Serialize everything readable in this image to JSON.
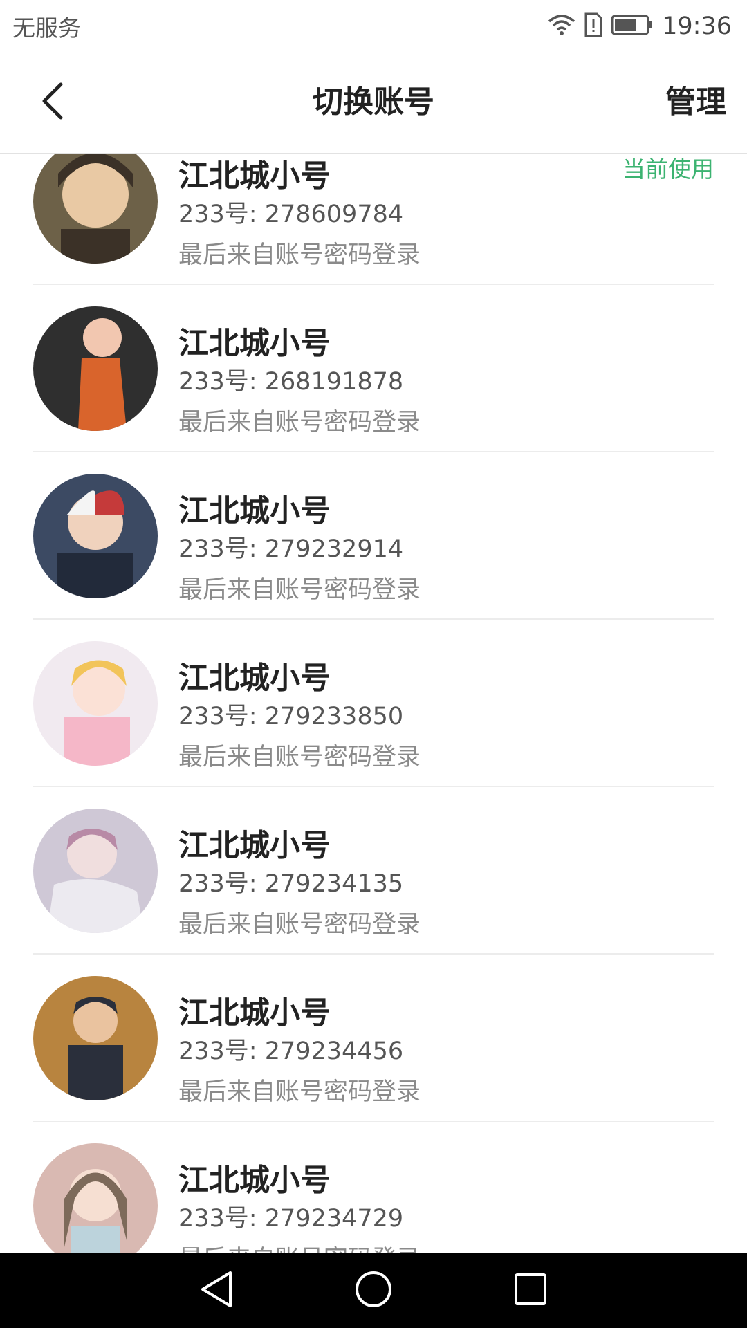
{
  "status": {
    "carrier": "无服务",
    "time": "19:36"
  },
  "header": {
    "title": "切换账号",
    "manage_label": "管理"
  },
  "accounts": [
    {
      "name": "江北城小号",
      "id": "233号: 278609784",
      "login": "最后来自账号密码登录",
      "badge": "当前使用",
      "avatar_bg": "#6d6148",
      "avatar_fg": "#3b3127"
    },
    {
      "name": "江北城小号",
      "id": "233号: 268191878",
      "login": "最后来自账号密码登录",
      "avatar_bg": "#2f2f2f",
      "avatar_fg": "#d9642c"
    },
    {
      "name": "江北城小号",
      "id": "233号: 279232914",
      "login": "最后来自账号密码登录",
      "avatar_bg": "#3c4a63",
      "avatar_fg": "#c53a3a"
    },
    {
      "name": "江北城小号",
      "id": "233号: 279233850",
      "login": "最后来自账号密码登录",
      "avatar_bg": "#f1eaf0",
      "avatar_fg": "#f2c45a"
    },
    {
      "name": "江北城小号",
      "id": "233号: 279234135",
      "login": "最后来自账号密码登录",
      "avatar_bg": "#cfc8d6",
      "avatar_fg": "#b88aa6"
    },
    {
      "name": "江北城小号",
      "id": "233号: 279234456",
      "login": "最后来自账号密码登录",
      "avatar_bg": "#b8843f",
      "avatar_fg": "#2a2f3b"
    },
    {
      "name": "江北城小号",
      "id": "233号: 279234729",
      "login": "最后来自账号密码登录",
      "avatar_bg": "#d9b9b2",
      "avatar_fg": "#7d6a5a"
    }
  ],
  "icons": {
    "back": "chevron-left-icon",
    "wifi": "wifi-icon",
    "sim": "sim-alert-icon",
    "battery": "battery-icon",
    "nav_back": "nav-back-icon",
    "nav_home": "nav-home-icon",
    "nav_recent": "nav-recent-icon"
  },
  "colors": {
    "badge": "#3cb371",
    "nav_bar": "#000000"
  }
}
